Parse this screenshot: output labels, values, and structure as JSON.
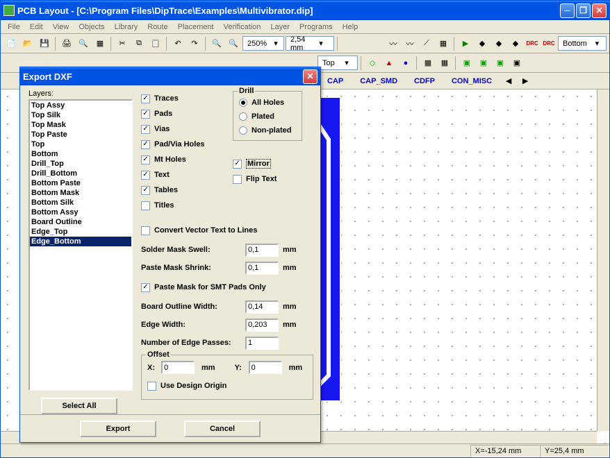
{
  "window": {
    "title": "PCB Layout - [C:\\Program Files\\DipTrace\\Examples\\Multivibrator.dip]"
  },
  "menubar": [
    "File",
    "Edit",
    "View",
    "Objects",
    "Library",
    "Route",
    "Placement",
    "Verification",
    "Layer",
    "Programs",
    "Help"
  ],
  "toolbar": {
    "zoom_value": "250%",
    "grid_value": "2,54 mm",
    "layer_top_value": "Top",
    "layer_select": "Bottom"
  },
  "categories": [
    "CAP",
    "CAP_SMD",
    "CDFP",
    "CON_MISC"
  ],
  "status": {
    "x": "X=-15,24 mm",
    "y": "Y=25,4 mm"
  },
  "dialog": {
    "title": "Export DXF",
    "layers_label": "Layers:",
    "layers": [
      "Top Assy",
      "Top Silk",
      "Top Mask",
      "Top Paste",
      "Top",
      "Bottom",
      "Drill_Top",
      "Drill_Bottom",
      "Bottom Paste",
      "Bottom Mask",
      "Bottom Silk",
      "Bottom Assy",
      "Board Outline",
      "Edge_Top",
      "Edge_Bottom"
    ],
    "selected_layer": "Edge_Bottom",
    "select_all": "Select All",
    "options": {
      "traces": "Traces",
      "pads": "Pads",
      "vias": "Vias",
      "pad_via_holes": "Pad/Via Holes",
      "mt_holes": "Mt Holes",
      "text": "Text",
      "tables": "Tables",
      "titles": "Titles"
    },
    "drill": {
      "legend": "Drill",
      "all_holes": "All Holes",
      "plated": "Plated",
      "non_plated": "Non-plated"
    },
    "mirror": "Mirror",
    "flip_text": "Flip Text",
    "convert_text": "Convert Vector Text to Lines",
    "solder_mask_swell": {
      "label": "Solder Mask Swell:",
      "value": "0,1",
      "unit": "mm"
    },
    "paste_mask_shrink": {
      "label": "Paste Mask Shrink:",
      "value": "0,1",
      "unit": "mm"
    },
    "paste_mask_smt": "Paste Mask for SMT Pads Only",
    "board_outline_width": {
      "label": "Board Outline Width:",
      "value": "0,14",
      "unit": "mm"
    },
    "edge_width": {
      "label": "Edge Width:",
      "value": "0,203",
      "unit": "mm"
    },
    "num_edge_passes": {
      "label": "Number of Edge Passes:",
      "value": "1"
    },
    "offset": {
      "legend": "Offset",
      "x_label": "X:",
      "x_value": "0",
      "x_unit": "mm",
      "y_label": "Y:",
      "y_value": "0",
      "y_unit": "mm"
    },
    "use_design_origin": "Use Design Origin",
    "export_btn": "Export",
    "cancel_btn": "Cancel"
  }
}
